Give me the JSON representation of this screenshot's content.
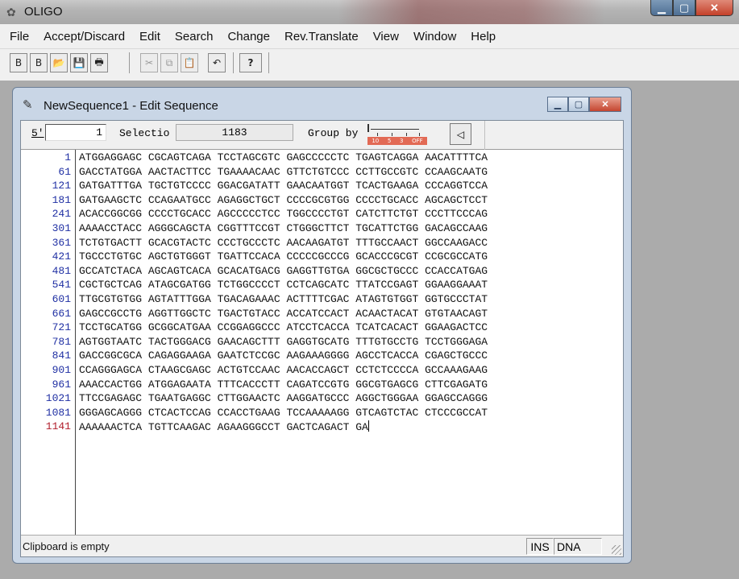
{
  "app": {
    "title": "OLIGO"
  },
  "menu": [
    "File",
    "Accept/Discard",
    "Edit",
    "Search",
    "Change",
    "Rev.Translate",
    "View",
    "Window",
    "Help"
  ],
  "toolbar": {
    "buttons": [
      {
        "icon": "new-sequence-icon",
        "glyph": "B"
      },
      {
        "icon": "new-document-icon",
        "glyph": "B"
      },
      {
        "icon": "open-folder-icon",
        "glyph": "📂"
      },
      {
        "icon": "save-disk-icon",
        "glyph": "💾"
      },
      {
        "icon": "print-icon",
        "glyph": "🖶"
      },
      {
        "icon": "cut-icon",
        "glyph": "✂"
      },
      {
        "icon": "copy-icon",
        "glyph": "⧉"
      },
      {
        "icon": "paste-icon",
        "glyph": "📋"
      },
      {
        "icon": "undo-icon",
        "glyph": "↶"
      },
      {
        "icon": "help-pointer-icon",
        "glyph": "?"
      }
    ]
  },
  "window": {
    "title": "NewSequence1 - Edit Sequence",
    "five_prime_label": "5'",
    "position_value": "1",
    "selection_label": "Selectio",
    "selection_value": "1183",
    "group_by_label": "Group by",
    "group_scale": [
      "10",
      "5",
      "3",
      "OFF"
    ]
  },
  "sequence_rows": [
    {
      "pos": "1",
      "seq": "ATGGAGGAGC CGCAGTCAGA TCCTAGCGTC GAGCCCCCTC TGAGTCAGGA AACATTTTCA"
    },
    {
      "pos": "61",
      "seq": "GACCTATGGA AACTACTTCC TGAAAACAAC GTTCTGTCCC CCTTGCCGTC CCAAGCAATG"
    },
    {
      "pos": "121",
      "seq": "GATGATTTGA TGCTGTCCCC GGACGATATT GAACAATGGT TCACTGAAGA CCCAGGTCCA"
    },
    {
      "pos": "181",
      "seq": "GATGAAGCTC CCAGAATGCC AGAGGCTGCT CCCCGCGTGG CCCCTGCACC AGCAGCTCCT"
    },
    {
      "pos": "241",
      "seq": "ACACCGGCGG CCCCTGCACC AGCCCCCTCC TGGCCCCTGT CATCTTCTGT CCCTTCCCAG"
    },
    {
      "pos": "301",
      "seq": "AAAACCTACC AGGGCAGCTA CGGTTTCCGT CTGGGCTTCT TGCATTCTGG GACAGCCAAG"
    },
    {
      "pos": "361",
      "seq": "TCTGTGACTT GCACGTACTC CCCTGCCCTC AACAAGATGT TTTGCCAACT GGCCAAGACC"
    },
    {
      "pos": "421",
      "seq": "TGCCCTGTGC AGCTGTGGGT TGATTCCACA CCCCCGCCCG GCACCCGCGT CCGCGCCATG"
    },
    {
      "pos": "481",
      "seq": "GCCATCTACA AGCAGTCACA GCACATGACG GAGGTTGTGA GGCGCTGCCC CCACCATGAG"
    },
    {
      "pos": "541",
      "seq": "CGCTGCTCAG ATAGCGATGG TCTGGCCCCT CCTCAGCATC TTATCCGAGT GGAAGGAAAT"
    },
    {
      "pos": "601",
      "seq": "TTGCGTGTGG AGTATTTGGA TGACAGAAAC ACTTTTCGAC ATAGTGTGGT GGTGCCCTAT"
    },
    {
      "pos": "661",
      "seq": "GAGCCGCCTG AGGTTGGCTC TGACTGTACC ACCATCCACT ACAACTACAT GTGTAACAGT"
    },
    {
      "pos": "721",
      "seq": "TCCTGCATGG GCGGCATGAA CCGGAGGCCC ATCCTCACCA TCATCACACT GGAAGACTCC"
    },
    {
      "pos": "781",
      "seq": "AGTGGTAATC TACTGGGACG GAACAGCTTT GAGGTGCATG TTTGTGCCTG TCCTGGGAGA"
    },
    {
      "pos": "841",
      "seq": "GACCGGCGCA CAGAGGAAGA GAATCTCCGC AAGAAAGGGG AGCCTCACCA CGAGCTGCCC"
    },
    {
      "pos": "901",
      "seq": "CCAGGGAGCA CTAAGCGAGC ACTGTCCAAC AACACCAGCT CCTCTCCCCA GCCAAAGAAG"
    },
    {
      "pos": "961",
      "seq": "AAACCACTGG ATGGAGAATA TTTCACCCTT CAGATCCGTG GGCGTGAGCG CTTCGAGATG"
    },
    {
      "pos": "1021",
      "seq": "TTCCGAGAGC TGAATGAGGC CTTGGAACTC AAGGATGCCC AGGCTGGGAA GGAGCCAGGG"
    },
    {
      "pos": "1081",
      "seq": "GGGAGCAGGG CTCACTCCAG CCACCTGAAG TCCAAAAAGG GTCAGTCTAC CTCCCGCCAT"
    },
    {
      "pos": "1141",
      "seq": "AAAAAACTCA TGTTCAAGAC AGAAGGGCCT GACTCAGACT GA"
    }
  ],
  "status": {
    "message": "Clipboard is empty",
    "ins": "INS",
    "mode": "DNA"
  },
  "colors": {
    "position_number": "#1f2fa3",
    "last_position_number": "#b01c2a",
    "group_scale": "#e26a55"
  }
}
